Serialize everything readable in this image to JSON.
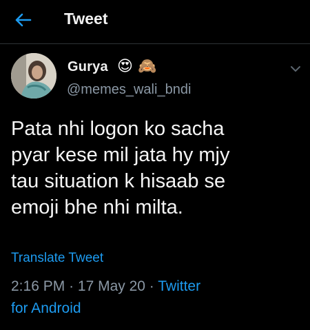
{
  "header": {
    "title": "Tweet"
  },
  "tweet": {
    "author_name": "Gurya",
    "author_emojis": [
      "😍",
      "🙈"
    ],
    "author_handle": "@memes_wali_bndi",
    "text_lines": [
      "Pata nhi logon ko sacha",
      "pyar kese mil jata hy mjy",
      "tau situation k hisaab se",
      "emoji bhe nhi milta."
    ],
    "translate_label": "Translate Tweet",
    "time": "2:16 PM",
    "date": "17 May 20",
    "source_line1": "Twitter",
    "source_line2": "for Android"
  },
  "colors": {
    "accent": "#1d9bf0",
    "muted": "#8b98a5",
    "background": "#000000"
  },
  "icons": {
    "back": "arrow-left-icon",
    "more": "chevron-down-icon"
  }
}
